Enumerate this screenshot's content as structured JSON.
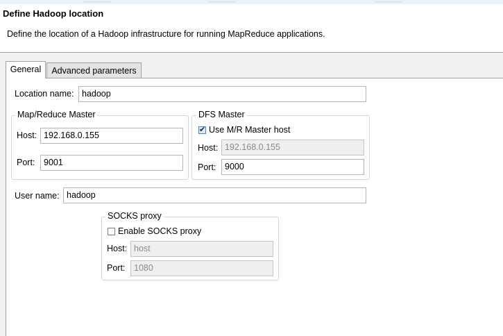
{
  "header": {
    "title": "Define Hadoop location",
    "subtitle": "Define the location of a Hadoop infrastructure for running MapReduce applications."
  },
  "tabs": [
    {
      "label": "General",
      "active": true
    },
    {
      "label": "Advanced parameters",
      "active": false
    }
  ],
  "general": {
    "location_name": {
      "label": "Location name:",
      "value": "hadoop"
    },
    "mapreduce_master": {
      "title": "Map/Reduce Master",
      "host": {
        "label": "Host:",
        "value": "192.168.0.155"
      },
      "port": {
        "label": "Port:",
        "value": "9001"
      }
    },
    "dfs_master": {
      "title": "DFS Master",
      "use_mr_master_host": {
        "label": "Use M/R Master host",
        "checked": true
      },
      "host": {
        "label": "Host:",
        "value": "192.168.0.155",
        "disabled": true
      },
      "port": {
        "label": "Port:",
        "value": "9000"
      }
    },
    "user_name": {
      "label": "User name:",
      "value": "hadoop"
    },
    "socks_proxy": {
      "title": "SOCKS proxy",
      "enable": {
        "label": "Enable SOCKS proxy",
        "checked": false
      },
      "host": {
        "label": "Host:",
        "value": "host",
        "disabled": true
      },
      "port": {
        "label": "Port:",
        "value": "1080",
        "disabled": true
      }
    }
  }
}
